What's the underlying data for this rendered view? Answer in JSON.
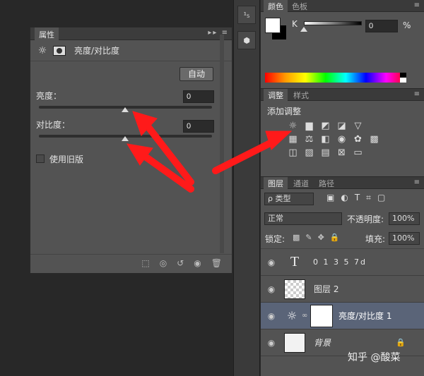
{
  "properties": {
    "tab": "属性",
    "menu": "▸▸ ≡",
    "title": "亮度/对比度",
    "auto_button": "自动",
    "brightness_label": "亮度：",
    "brightness_value": "0",
    "contrast_label": "对比度：",
    "contrast_value": "0",
    "legacy_label": "使用旧版"
  },
  "color_panel": {
    "tabs": [
      "颜色",
      "色板"
    ],
    "channel_label": "K",
    "value": "0",
    "unit": "%"
  },
  "adjustments_panel": {
    "tabs": [
      "调整",
      "样式"
    ],
    "heading": "添加调整"
  },
  "layers_panel": {
    "tabs": [
      "图层",
      "通道",
      "路径"
    ],
    "filter_kind": "ρ 类型",
    "blend_mode": "正常",
    "opacity_label": "不透明度:",
    "opacity_value": "100%",
    "lock_label": "锁定:",
    "fill_label": "填充:",
    "fill_value": "100%",
    "layers": [
      {
        "name": "0 1 3 5 7d",
        "type": "text"
      },
      {
        "name": "图层 2",
        "type": "pixel"
      },
      {
        "name": "亮度/对比度 1",
        "type": "adjustment",
        "selected": true
      },
      {
        "name": "背景",
        "type": "background"
      }
    ]
  },
  "watermark": "知乎 @酸菜",
  "colors": {
    "arrow": "#ff1a1a",
    "selected_layer": "#5a6478"
  }
}
